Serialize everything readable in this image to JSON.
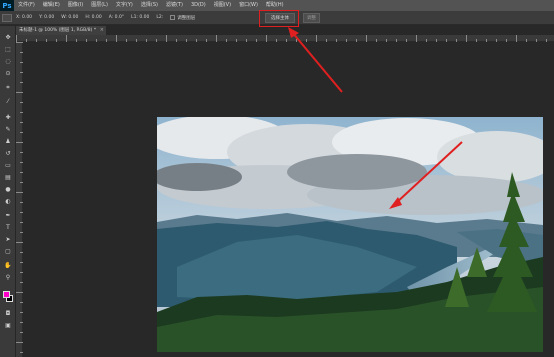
{
  "app": {
    "logo": "Ps"
  },
  "menu": [
    "文件(F)",
    "编辑(E)",
    "图像(I)",
    "图层(L)",
    "文字(Y)",
    "选择(S)",
    "滤镜(T)",
    "3D(D)",
    "视图(V)",
    "窗口(W)",
    "帮助(H)"
  ],
  "options": {
    "fields": [
      "X: 0.00",
      "Y: 0.00",
      "W: 0.00",
      "H: 0.00",
      "A: 0.0°",
      "L1: 0.00",
      "L2:"
    ],
    "check_label": "调整图层",
    "select_subject": "选择主体",
    "refine": "调整"
  },
  "document": {
    "tab_title": "未标题-1 @ 100% (图层 1, RGB/8) *",
    "close": "×"
  },
  "ruler": {
    "labels": [
      "0",
      "50",
      "100",
      "150",
      "200",
      "250",
      "300",
      "350",
      "400",
      "450"
    ]
  },
  "toolbar": {
    "icons": [
      "move-icon",
      "marquee-icon",
      "lasso-icon",
      "quick-select-icon",
      "crop-icon",
      "eyedropper-icon",
      "healing-icon",
      "brush-icon",
      "stamp-icon",
      "history-brush-icon",
      "eraser-icon",
      "gradient-icon",
      "blur-icon",
      "dodge-icon",
      "pen-icon",
      "type-icon",
      "path-select-icon",
      "shape-icon",
      "hand-icon",
      "zoom-icon"
    ],
    "foreground_color": "#ff00c8",
    "background_color": "#000000"
  },
  "annotation_color": "#e02020"
}
